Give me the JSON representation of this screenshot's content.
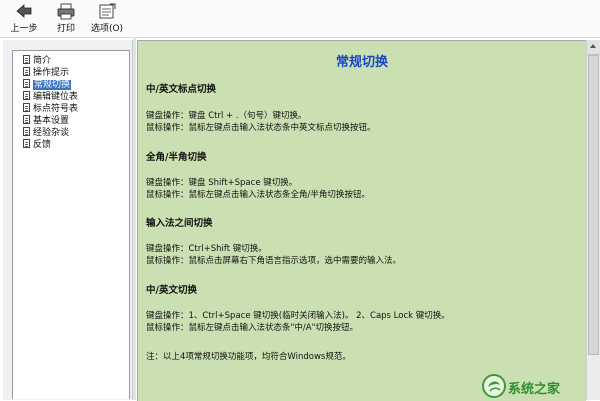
{
  "toolbar": {
    "back_label": "上一步",
    "print_label": "打印",
    "options_label": "选项(O)"
  },
  "tree": {
    "items": [
      {
        "label": "简介",
        "selected": false
      },
      {
        "label": "操作提示",
        "selected": false
      },
      {
        "label": "常规切换",
        "selected": true
      },
      {
        "label": "编辑键位表",
        "selected": false
      },
      {
        "label": "标点符号表",
        "selected": false
      },
      {
        "label": "基本设置",
        "selected": false
      },
      {
        "label": "经验杂谈",
        "selected": false
      },
      {
        "label": "反馈",
        "selected": false
      }
    ]
  },
  "content": {
    "title": "常规切换",
    "sections": [
      {
        "heading": "中/英文标点切换",
        "lines": [
          "键盘操作：键盘 Ctrl + .（句号）键切换。",
          "鼠标操作：鼠标左键点击输入法状态条中英文标点切换按钮。"
        ]
      },
      {
        "heading": "全角/半角切换",
        "lines": [
          "键盘操作：键盘 Shift+Space 键切换。",
          "鼠标操作：鼠标左键点击输入法状态条全角/半角切换按钮。"
        ]
      },
      {
        "heading": "输入法之间切换",
        "lines": [
          "键盘操作：Ctrl+Shift 键切换。",
          "鼠标操作：鼠标点击屏幕右下角语言指示选项，选中需要的输入法。"
        ]
      },
      {
        "heading": "中/英文切换",
        "lines": [
          "键盘操作：1、Ctrl+Space 键切换(临时关闭输入法)。 2、Caps Lock 键切换。",
          "鼠标操作：鼠标左键点击输入法状态条\"中/A\"切换按钮。"
        ]
      }
    ],
    "note": "注：以上4项常规切换功能项，均符合Windows规范。"
  },
  "watermark": {
    "text": "系统之家"
  }
}
